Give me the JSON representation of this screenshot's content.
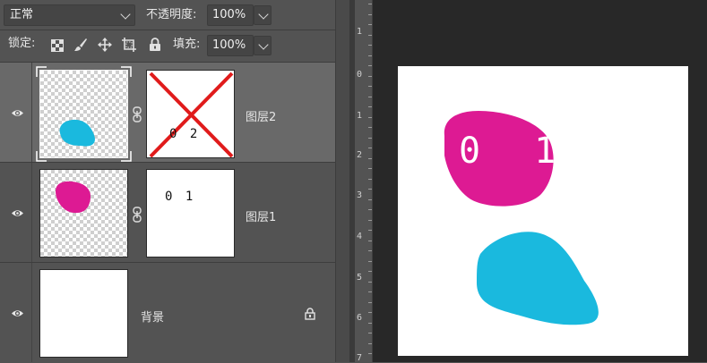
{
  "toolbar": {
    "blend_mode": "正常",
    "opacity_label": "不透明度:",
    "opacity_value": "100%",
    "lock_label": "锁定:",
    "fill_label": "填充:",
    "fill_value": "100%"
  },
  "layers": [
    {
      "name": "图层2",
      "mask_text": "0 2",
      "selected": true
    },
    {
      "name": "图层1",
      "mask_text": "0 1",
      "selected": false
    },
    {
      "name": "背景",
      "locked": true,
      "selected": false
    }
  ],
  "ruler": {
    "labels": [
      "1",
      "0",
      "1",
      "2",
      "3",
      "4",
      "5",
      "6",
      "7"
    ]
  },
  "canvas": {
    "text": "0 1"
  },
  "colors": {
    "panel": "#535353",
    "selected_row": "#696969",
    "magenta": "#dd1a93",
    "cyan": "#1ab9de",
    "red_cross": "#e01b1b",
    "canvas_bg": "#282828"
  }
}
